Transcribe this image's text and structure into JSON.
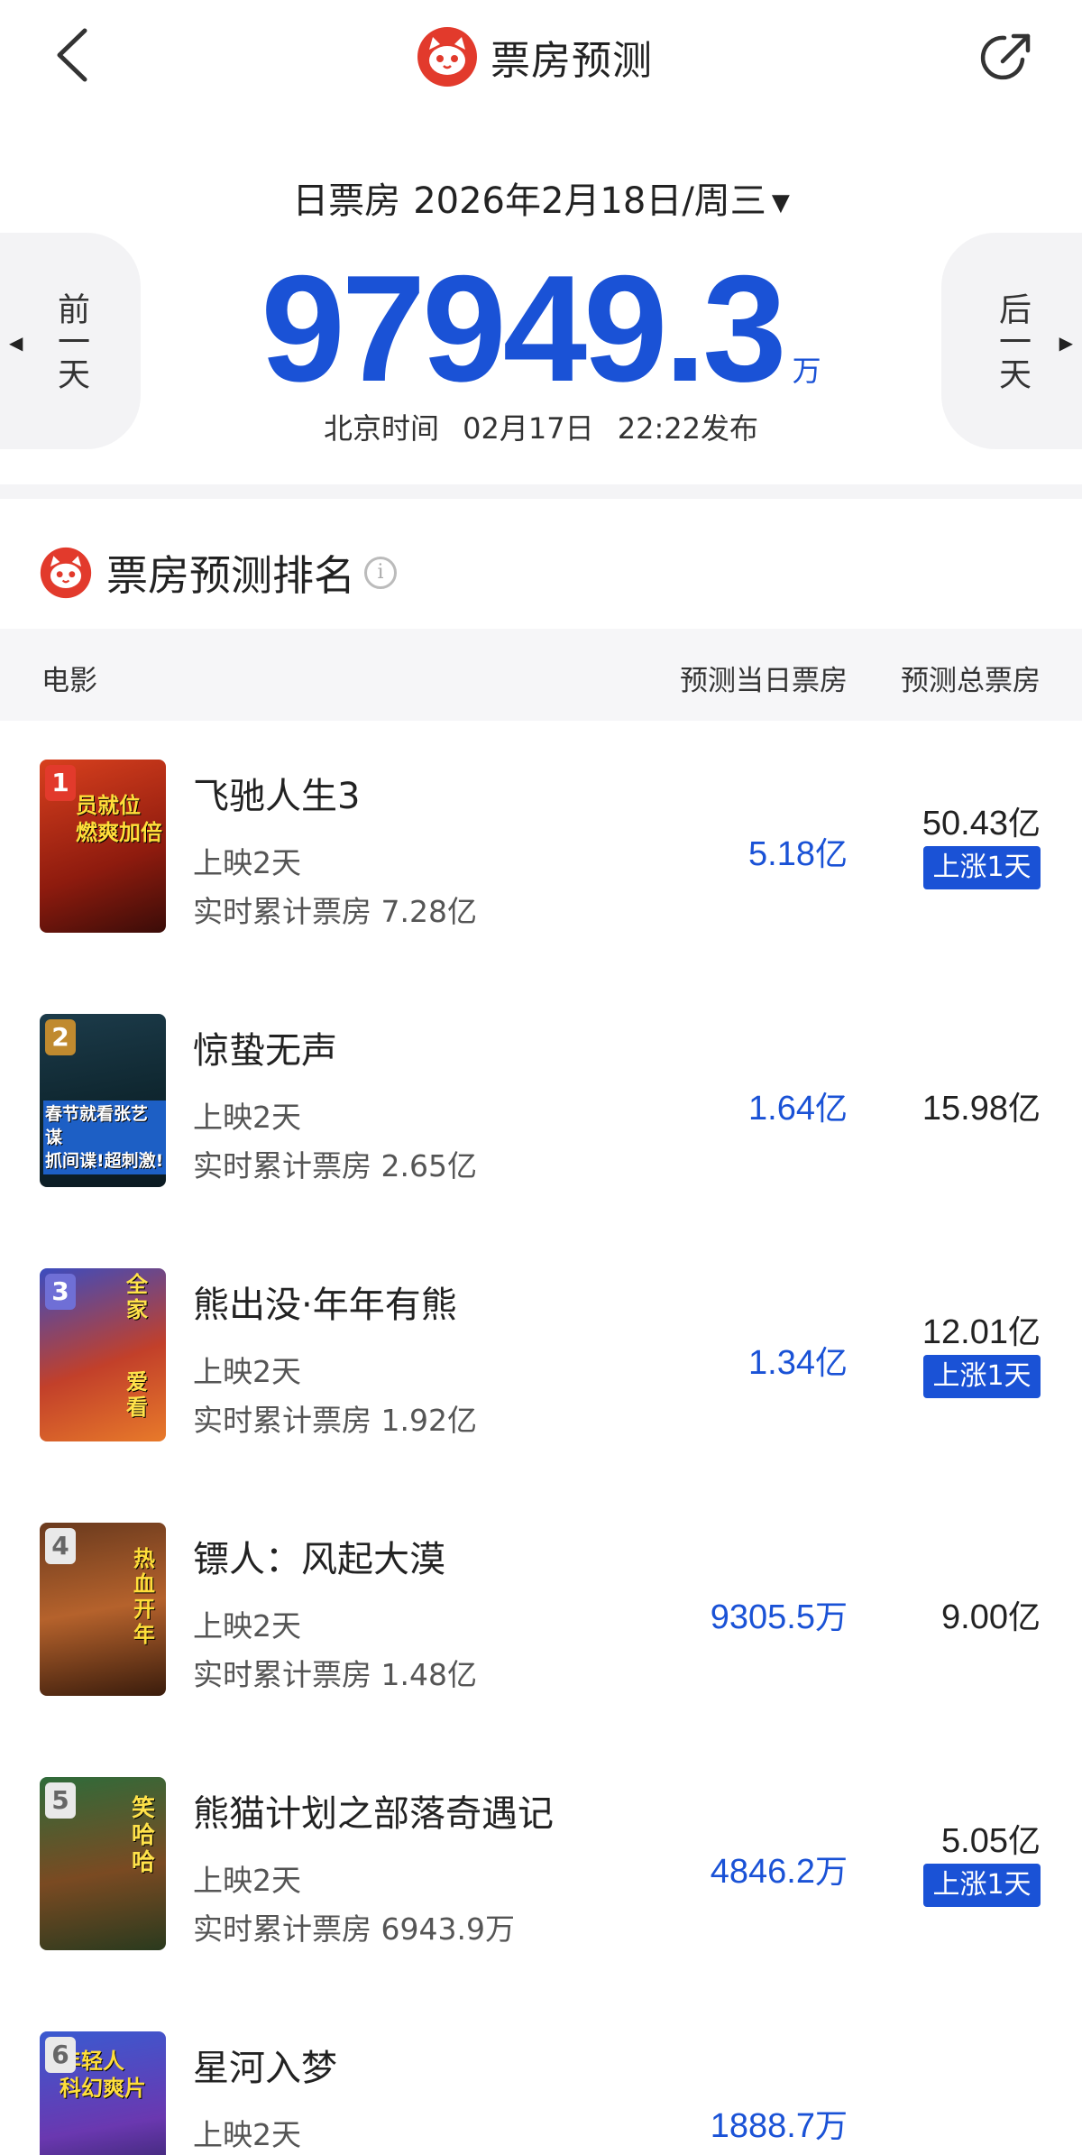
{
  "nav": {
    "title": "票房预测"
  },
  "header": {
    "type_label": "日票房",
    "date": "2026年2月18日/周三",
    "prev_label": "前一天",
    "next_label": "后一天",
    "total_value": "97949.3",
    "total_unit": "万",
    "publish_prefix": "北京时间",
    "publish_date": "02月17日",
    "publish_time": "22:22发布"
  },
  "ranking": {
    "title": "票房预测排名",
    "col_movie": "电影",
    "col_today": "预测当日票房",
    "col_total": "预测总票房",
    "rows": [
      {
        "rank": "1",
        "title": "飞驰人生3",
        "days": "上映2天",
        "cum": "实时累计票房 7.28亿",
        "today_num": "5.18",
        "today_unit": "亿",
        "total_num": "50.43",
        "total_unit": "亿",
        "badge": "上涨1天",
        "poster_text": "员就位\n燃爽加倍"
      },
      {
        "rank": "2",
        "title": "惊蛰无声",
        "days": "上映2天",
        "cum": "实时累计票房 2.65亿",
        "today_num": "1.64",
        "today_unit": "亿",
        "total_num": "15.98",
        "total_unit": "亿",
        "badge": "",
        "poster_text": "春节就看张艺谋\n抓间谍!超刺激!"
      },
      {
        "rank": "3",
        "title": "熊出没·年年有熊",
        "days": "上映2天",
        "cum": "实时累计票房 1.92亿",
        "today_num": "1.34",
        "today_unit": "亿",
        "total_num": "12.01",
        "total_unit": "亿",
        "badge": "上涨1天",
        "poster_text": "全家\n爱看"
      },
      {
        "rank": "4",
        "title": "镖人：风起大漠",
        "days": "上映2天",
        "cum": "实时累计票房 1.48亿",
        "today_num": "9305.5",
        "today_unit": "万",
        "total_num": "9.00",
        "total_unit": "亿",
        "badge": "",
        "poster_text": "热血开年"
      },
      {
        "rank": "5",
        "title": "熊猫计划之部落奇遇记",
        "days": "上映2天",
        "cum": "实时累计票房 6943.9万",
        "today_num": "4846.2",
        "today_unit": "万",
        "total_num": "5.05",
        "total_unit": "亿",
        "badge": "上涨1天",
        "poster_text": "笑哈哈"
      },
      {
        "rank": "6",
        "title": "星河入梦",
        "days": "上映2天",
        "cum": "",
        "today_num": "1888.7",
        "today_unit": "万",
        "total_num": "",
        "total_unit": "",
        "badge": "",
        "poster_text": "年轻人\n科幻爽片"
      }
    ]
  },
  "colors": {
    "accent_blue": "#1a52d6",
    "brand_red": "#e23a2c"
  },
  "icons": {
    "back": "chevron-left-icon",
    "share": "share-icon",
    "logo": "maoyan-cat-logo",
    "info": "info-icon",
    "dropdown": "caret-down-icon"
  }
}
